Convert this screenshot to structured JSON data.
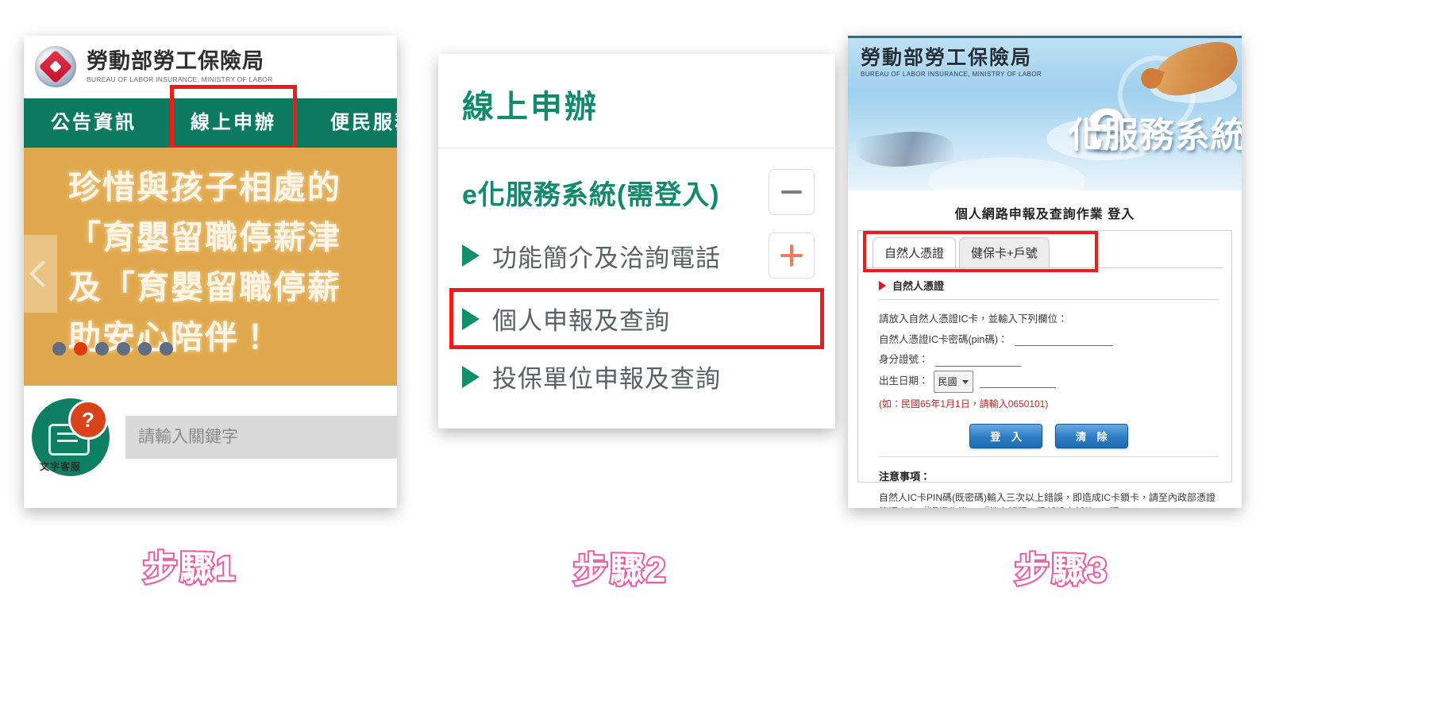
{
  "step1": {
    "org_name_cn": "勞動部勞工保險局",
    "org_name_en": "BUREAU OF LABOR INSURANCE, MINISTRY OF LABOR",
    "nav": [
      {
        "label": "公告資訊",
        "highlighted": false
      },
      {
        "label": "線上申辦",
        "highlighted": true
      },
      {
        "label": "便民服務",
        "highlighted": false
      }
    ],
    "banner": {
      "lines": [
        "珍惜與孩子相處的",
        "「育嬰留職停薪津",
        "及「育嬰留職停薪",
        "助安心陪伴！"
      ],
      "dot_count": 6,
      "active_dot_index": 1,
      "prev_arrow": "chevron-left-icon"
    },
    "chat": {
      "label": "文字客服",
      "badge": "?"
    },
    "search": {
      "placeholder": "請輸入關鍵字",
      "value": "",
      "button_icon": "search-icon"
    },
    "caption": "步驟1"
  },
  "step2": {
    "page_title": "線上申辦",
    "accordion": {
      "header": "e化服務系統(需登入)",
      "header_toggle": "minus-icon",
      "items": [
        {
          "label": "功能簡介及洽詢電話",
          "toggle": "plus-icon",
          "highlighted": false
        },
        {
          "label": "個人申報及查詢",
          "toggle": "",
          "highlighted": true
        },
        {
          "label": "投保單位申報及查詢",
          "toggle": "",
          "highlighted": false
        }
      ]
    },
    "caption": "步驟2"
  },
  "step3": {
    "hero": {
      "org_name_cn": "勞動部勞工保險局",
      "org_name_en": "BUREAU OF LABOR INSURANCE, MINISTRY OF LABOR",
      "brand_e": "e",
      "brand_sys": "化服務系統"
    },
    "page_title": "個人網路申報及查詢作業 登入",
    "tabs": [
      {
        "label": "自然人憑證",
        "active": true
      },
      {
        "label": "健保卡+戶號",
        "active": false
      }
    ],
    "tabs_highlighted": true,
    "pane_heading": "自然人憑證",
    "form": {
      "instruction": "請放入自然人憑證IC卡，並輸入下列欄位：",
      "fields": [
        {
          "label": "自然人憑證IC卡密碼(pin碼)：",
          "value": ""
        },
        {
          "label": "身分證號：",
          "value": ""
        }
      ],
      "birth_label": "出生日期：",
      "birth_select_value": "民國",
      "birth_value": "",
      "birth_hint": "(如：民國65年1月1日，請輸入0650101)"
    },
    "buttons": [
      {
        "label": "登 入"
      },
      {
        "label": "清 除"
      }
    ],
    "notes_title": "注意事項：",
    "notes_body": "自然人IC卡PIN碼(既密碼)輸入三次以上錯誤，即造成IC卡鎖卡，請至內政部憑證管理中心\\『憑證作業』\\『鎖卡解碼』重新設定新的PIN碼。",
    "caption": "步驟3"
  },
  "colors": {
    "brand_green": "#0b7a5f",
    "accent_teal": "#118a6d",
    "banner_orange": "#e0a84c",
    "highlight_red": "#ee1c1c",
    "search_red": "#de3c11",
    "caption_pink": "#ef5ba0",
    "button_blue": "#2f7fc4"
  }
}
